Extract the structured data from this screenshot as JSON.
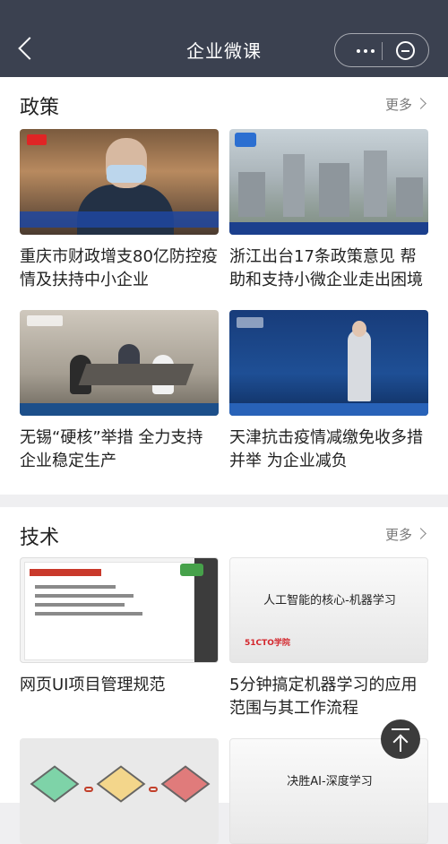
{
  "header": {
    "title": "企业微课"
  },
  "sections": [
    {
      "title": "政策",
      "more_label": "更多",
      "cards": [
        {
          "title": "重庆市财政增支80亿防控疫情及扶持中小企业",
          "thumbnail": "news-photo"
        },
        {
          "title": "浙江出台17条政策意见 帮助和支持小微企业走出困境",
          "thumbnail": "city-aerial-photo"
        },
        {
          "title": "无锡“硬核”举措 全力支持企业稳定生产",
          "thumbnail": "office-meeting-photo"
        },
        {
          "title": "天津抗击疫情减缴免收多措并举 为企业减负",
          "thumbnail": "news-anchor-photo"
        }
      ]
    },
    {
      "title": "技术",
      "more_label": "更多",
      "cards": [
        {
          "title": "网页UI项目管理规范",
          "thumbnail": "slide-screenshot"
        },
        {
          "title": "5分钟搞定机器学习的应用范围与其工作流程",
          "thumbnail": "course-cover",
          "thumb_text": "人工智能的核心-机器学习",
          "thumb_brand": "51CTO学院"
        },
        {
          "title": "",
          "thumbnail": "cubes-diagram"
        },
        {
          "title": "",
          "thumbnail": "course-cover",
          "thumb_text": "决胜AI-深度学习"
        }
      ]
    }
  ],
  "colors": {
    "navbar": "#3b4150",
    "background": "#efeff1"
  }
}
